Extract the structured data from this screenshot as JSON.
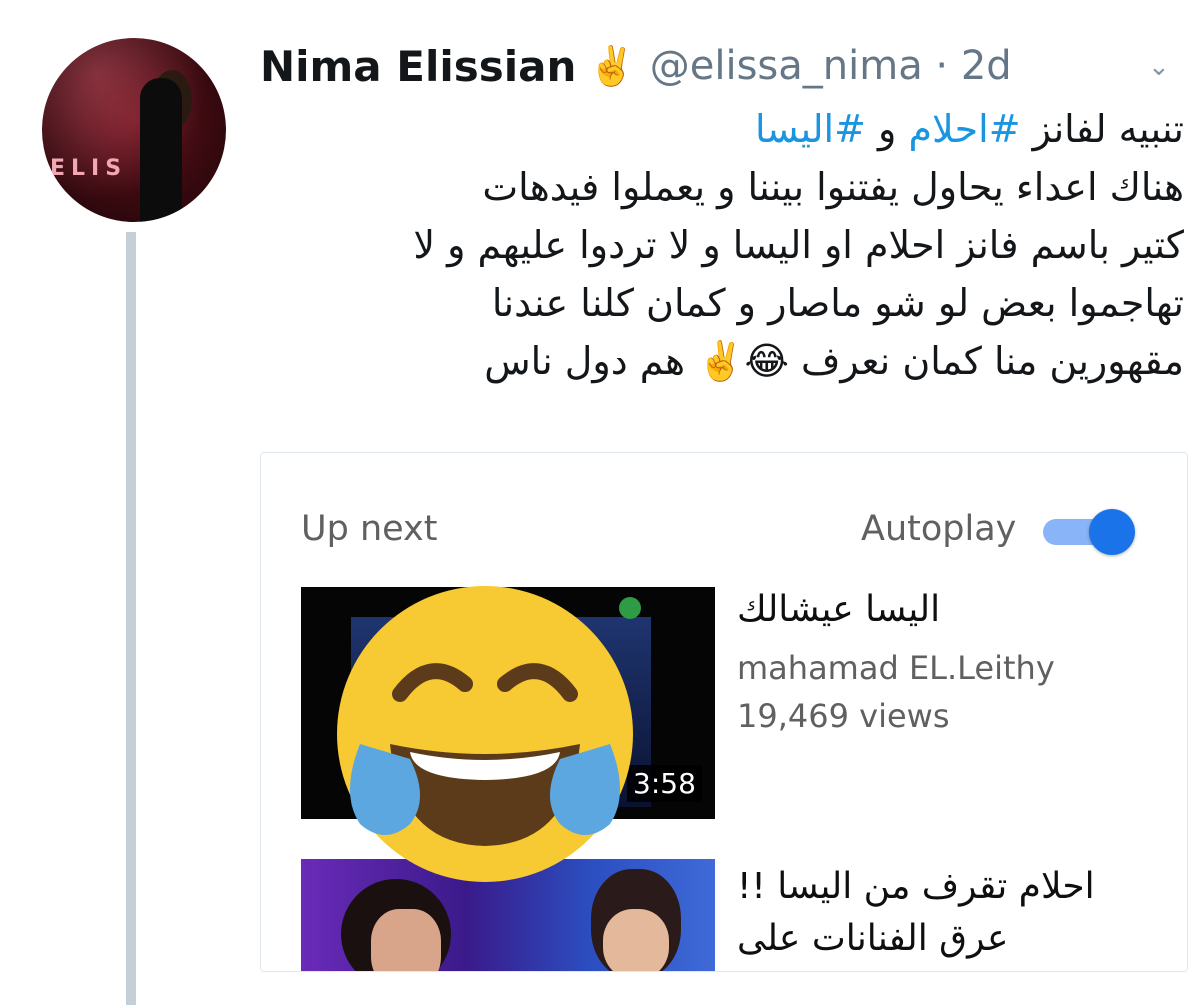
{
  "tweet": {
    "author_name": "Nima Elissian",
    "author_badge": "✌️",
    "handle_time": "@elissa_nima · 2d",
    "menu_icon": "chevron-down-icon",
    "avatar_sign": "ELIS",
    "lines": [
      "تنبيه لفانز #احلام و #اليسا",
      "هناك اعداء يحاول يفتنوا بيننا و يعملوا فيدهات",
      "كتير باسم فانز احلام او اليسا و لا تردوا عليهم و لا",
      "تهاجموا بعض لو شو ماصار و كمان كلنا عندنا",
      "مقهورين منا كمان نعرف 😂✌️ هم دول ناس"
    ],
    "line1_parts": {
      "prefix": "تنبيه لفانز ",
      "hashtag1": "#احلام",
      "middle": " و ",
      "hashtag2": "#اليسا"
    }
  },
  "card": {
    "up_next_label": "Up next",
    "autoplay_label": "Autoplay",
    "autoplay_on": true,
    "video1": {
      "title": "اليسا عيشالك",
      "channel": "mahamad EL.Leithy",
      "views": "19,469 views",
      "duration": "3:58"
    },
    "video2": {
      "title_lines": [
        "احلام تقرف من اليسا !!",
        "عرق الفنانات على"
      ]
    }
  },
  "overlay": {
    "emoji_icon": "face-with-tears-of-joy-icon"
  },
  "colors": {
    "hashtag": "#1b95e0",
    "handle": "#657786",
    "toggle_on": "#1a73e8",
    "thread_line": "#c5cfd8"
  }
}
